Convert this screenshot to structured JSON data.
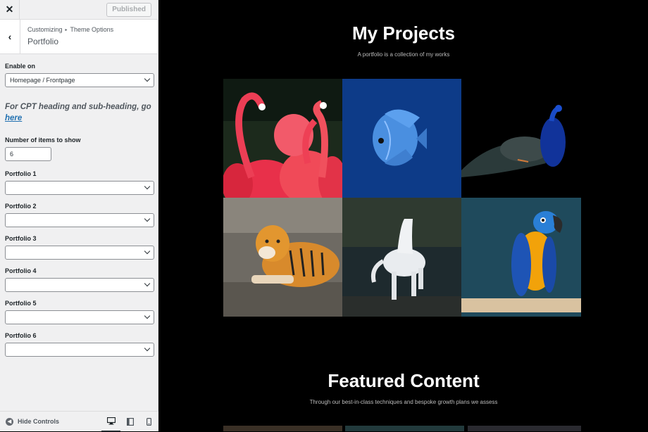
{
  "customizer": {
    "publish_label": "Published",
    "breadcrumb": [
      "Customizing",
      "Theme Options"
    ],
    "section_title": "Portfolio",
    "enable_label": "Enable on",
    "enable_value": "Homepage / Frontpage",
    "note_text": "For CPT heading and sub-heading, go ",
    "note_link": "here",
    "items_label": "Number of items to show",
    "items_value": "6",
    "portfolio_fields": [
      {
        "label": "Portfolio 1",
        "value": ""
      },
      {
        "label": "Portfolio 2",
        "value": ""
      },
      {
        "label": "Portfolio 3",
        "value": ""
      },
      {
        "label": "Portfolio 4",
        "value": ""
      },
      {
        "label": "Portfolio 5",
        "value": ""
      },
      {
        "label": "Portfolio 6",
        "value": ""
      }
    ],
    "hide_controls_label": "Hide Controls",
    "icons": [
      "close-icon",
      "back-icon",
      "desktop-icon",
      "tablet-icon",
      "mobile-icon"
    ]
  },
  "preview": {
    "projects_title": "My Projects",
    "projects_subtitle": "A portfolio is a collection of my works",
    "tiles": [
      "flamingos",
      "blue fish",
      "peacock",
      "tiger",
      "white horse",
      "macaw parrot"
    ],
    "featured_title": "Featured Content",
    "featured_subtitle": "Through our best-in-class techniques and bespoke growth plans we assess"
  },
  "colors": {
    "panel_bg": "#f0f0f1",
    "preview_bg": "#000000",
    "link": "#2271b1"
  }
}
